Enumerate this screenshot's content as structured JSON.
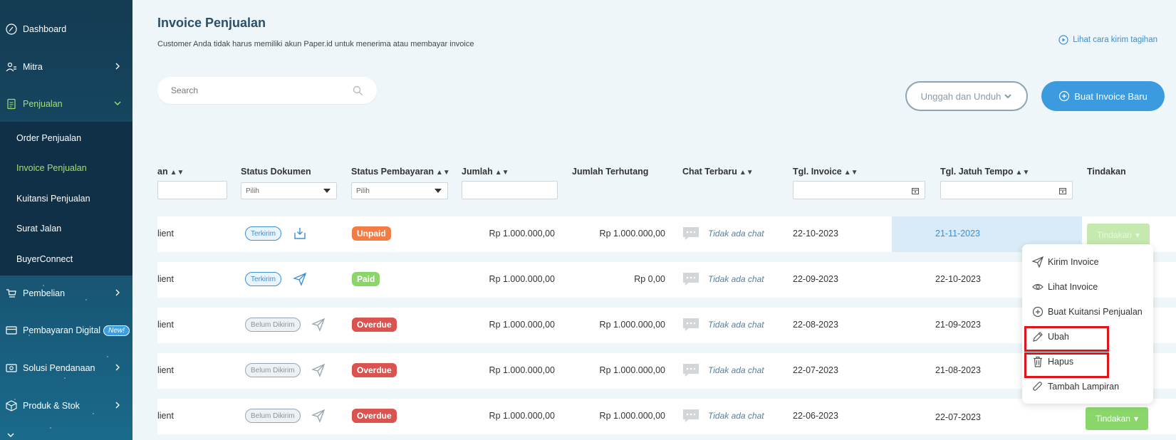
{
  "sidebar": {
    "items": [
      {
        "label": "Dashboard"
      },
      {
        "label": "Mitra"
      },
      {
        "label": "Penjualan"
      },
      {
        "label": "Pembelian"
      },
      {
        "label": "Pembayaran Digital"
      },
      {
        "label": "Solusi Pendanaan"
      },
      {
        "label": "Produk & Stok"
      }
    ],
    "sub_items": [
      "Order Penjualan",
      "Invoice Penjualan",
      "Kuitansi Penjualan",
      "Surat Jalan",
      "BuyerConnect"
    ],
    "new_badge": "New!"
  },
  "header": {
    "title": "Invoice Penjualan",
    "subtitle": "Customer Anda tidak harus memiliki akun Paper.id untuk menerima atau membayar invoice",
    "help_link": "Lihat cara kirim tagihan"
  },
  "search": {
    "placeholder": "Search"
  },
  "actions": {
    "upload_download": "Unggah dan Unduh",
    "create_invoice": "Buat Invoice Baru"
  },
  "table": {
    "headers": {
      "client_partial": "an",
      "status_doc": "Status Dokumen",
      "status_pay": "Status Pembayaran",
      "amount": "Jumlah",
      "owed": "Jumlah Terhutang",
      "chat": "Chat Terbaru",
      "invoice_date": "Tgl. Invoice",
      "due_date": "Tgl. Jatuh Tempo",
      "action": "Tindakan"
    },
    "select_placeholder": "Pilih",
    "rows": [
      {
        "client": "lient",
        "doc_status": "Terkirim",
        "pay_status": "Unpaid",
        "amount": "Rp 1.000.000,00",
        "owed": "Rp 1.000.000,00",
        "chat": "Tidak ada chat",
        "invoice_date": "22-10-2023",
        "due_date": "21-11-2023",
        "action": "Tindakan"
      },
      {
        "client": "lient",
        "doc_status": "Terkirim",
        "pay_status": "Paid",
        "amount": "Rp 1.000.000,00",
        "owed": "Rp 0,00",
        "chat": "Tidak ada chat",
        "invoice_date": "22-09-2023",
        "due_date": "22-10-2023"
      },
      {
        "client": "lient",
        "doc_status": "Belum Dikirim",
        "pay_status": "Overdue",
        "amount": "Rp 1.000.000,00",
        "owed": "Rp 1.000.000,00",
        "chat": "Tidak ada chat",
        "invoice_date": "22-08-2023",
        "due_date": "21-09-2023"
      },
      {
        "client": "lient",
        "doc_status": "Belum Dikirim",
        "pay_status": "Overdue",
        "amount": "Rp 1.000.000,00",
        "owed": "Rp 1.000.000,00",
        "chat": "Tidak ada chat",
        "invoice_date": "22-07-2023",
        "due_date": "21-08-2023"
      },
      {
        "client": "lient",
        "doc_status": "Belum Dikirim",
        "pay_status": "Overdue",
        "amount": "Rp 1.000.000,00",
        "owed": "Rp 1.000.000,00",
        "chat": "Tidak ada chat",
        "invoice_date": "22-06-2023",
        "due_date": "22-07-2023",
        "action": "Tindakan"
      }
    ]
  },
  "menu": {
    "items": [
      "Kirim Invoice",
      "Lihat Invoice",
      "Buat Kuitansi Penjualan",
      "Ubah",
      "Hapus",
      "Tambah Lampiran"
    ]
  },
  "colors": {
    "accent": "#3c9bdf",
    "active_green": "#a4e06b",
    "unpaid": "#f37c44",
    "paid": "#8bd66b",
    "overdue": "#d9534f",
    "highlight_red": "#e0141a"
  }
}
